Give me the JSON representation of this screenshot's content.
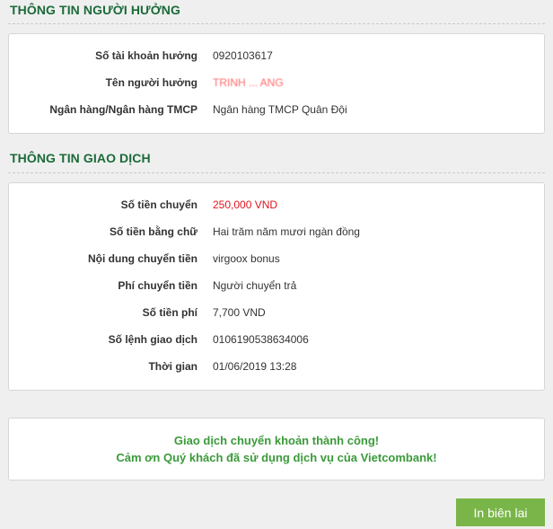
{
  "beneficiary": {
    "title": "THÔNG TIN NGƯỜI HƯỞNG",
    "rows": [
      {
        "label": "Số tài khoản hưởng",
        "value": "0920103617"
      },
      {
        "label": "Tên người hưởng",
        "value": "TRINH ... ANG"
      },
      {
        "label": "Ngân hàng/Ngân hàng TMCP",
        "value": "Ngân hàng TMCP Quân Đội"
      }
    ]
  },
  "transaction": {
    "title": "THÔNG TIN GIAO DỊCH",
    "rows": [
      {
        "label": "Số tiền chuyển",
        "value": "250,000 VND"
      },
      {
        "label": "Số tiền bằng chữ",
        "value": "Hai trăm năm mươi ngàn đồng"
      },
      {
        "label": "Nội dung chuyển tiền",
        "value": "virgoox bonus"
      },
      {
        "label": "Phí chuyển tiền",
        "value": "Người chuyển trả"
      },
      {
        "label": "Số tiền phí",
        "value": "7,700 VND"
      },
      {
        "label": "Số lệnh giao dịch",
        "value": "0106190538634006"
      },
      {
        "label": "Thời gian",
        "value": "01/06/2019 13:28"
      }
    ]
  },
  "result": {
    "line1": "Giao dịch chuyển khoản thành công!",
    "line2": "Cảm ơn Quý khách đã sử dụng dịch vụ của Vietcombank!"
  },
  "actions": {
    "print_label": "In biên lai"
  },
  "colors": {
    "heading": "#1b6a3a",
    "amount": "#e0141e",
    "success": "#3a9a3a",
    "button": "#7ab549"
  }
}
